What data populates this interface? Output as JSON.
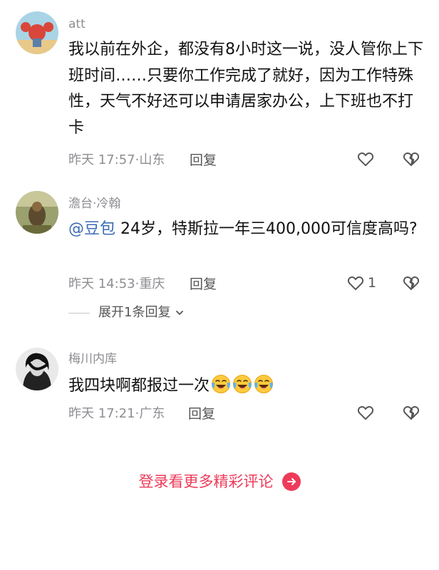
{
  "comments": [
    {
      "username": "att",
      "text": "我以前在外企，都没有8小时这一说，没人管你上下班时间……只要你工作完成了就好，因为工作特殊性，天气不好还可以申请居家办公，上下班也不打卡",
      "time": "昨天 17:57",
      "location": "山东",
      "reply_label": "回复",
      "like_count": ""
    },
    {
      "username": "澹台·冷翰",
      "mention": "@豆包",
      "text": " 24岁，特斯拉一年三400,000可信度高吗?",
      "time": "昨天 14:53",
      "location": "重庆",
      "reply_label": "回复",
      "like_count": "1",
      "expand_label": "展开1条回复"
    },
    {
      "username": "梅川内库",
      "text": "我四块啊都报过一次",
      "time": "昨天 17:21",
      "location": "广东",
      "reply_label": "回复",
      "like_count": "",
      "emojis": [
        "crying-laughing-emoji",
        "crying-laughing-emoji",
        "crying-laughing-emoji"
      ]
    }
  ],
  "footer": {
    "login_label": "登录看更多精彩评论"
  },
  "colors": {
    "accent": "#ee3b5a",
    "mention": "#3b6bb5",
    "meta": "#8e8e93"
  }
}
